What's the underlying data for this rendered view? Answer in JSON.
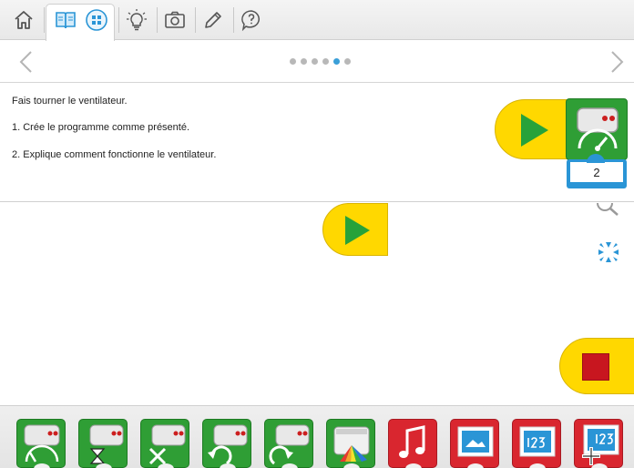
{
  "toolbar": {
    "items": [
      {
        "name": "home",
        "icon": "home-icon"
      },
      {
        "name": "book",
        "icon": "book-icon",
        "active": true
      },
      {
        "name": "gallery",
        "icon": "grid-icon"
      },
      {
        "name": "idea",
        "icon": "lightbulb-icon"
      },
      {
        "name": "camera",
        "icon": "camera-icon"
      },
      {
        "name": "edit",
        "icon": "pencil-icon"
      },
      {
        "name": "help",
        "icon": "help-icon"
      }
    ]
  },
  "navigation": {
    "prev_icon": "chevron-left-icon",
    "next_icon": "chevron-right-icon",
    "page_count": 6,
    "active_page": 5
  },
  "instructions": {
    "line1": "Fais tourner le ventilateur.",
    "line2": "1. Crée le programme comme présenté.",
    "line3": "2. Explique comment fonctionne le ventilateur."
  },
  "example_program": {
    "start_icon": "play-icon",
    "motor_icon": "motor-power-icon",
    "power_value": "2"
  },
  "canvas": {
    "start_icon": "play-icon",
    "zoom_icon": "magnifier-icon",
    "fit_icon": "collapse-arrows-icon",
    "stop_icon": "stop-icon"
  },
  "palette": {
    "blocks": [
      {
        "icon": "motor-power-icon",
        "color": "#2f9e35"
      },
      {
        "icon": "motor-time-icon",
        "color": "#2f9e35"
      },
      {
        "icon": "motor-off-icon",
        "color": "#2f9e35"
      },
      {
        "icon": "motor-ccw-icon",
        "color": "#2f9e35"
      },
      {
        "icon": "motor-cw-icon",
        "color": "#2f9e35"
      },
      {
        "icon": "light-color-icon",
        "color": "#2f9e35"
      },
      {
        "icon": "sound-icon",
        "color": "#d9262f"
      },
      {
        "icon": "display-image-icon",
        "color": "#d9262f"
      },
      {
        "icon": "display-number-icon",
        "color": "#d9262f"
      },
      {
        "icon": "add-number-icon",
        "color": "#d9262f"
      }
    ]
  },
  "colors": {
    "accent": "#3a9fd8",
    "start_yellow": "#ffd800",
    "motor_green": "#2f9e35",
    "display_red": "#d9262f"
  }
}
